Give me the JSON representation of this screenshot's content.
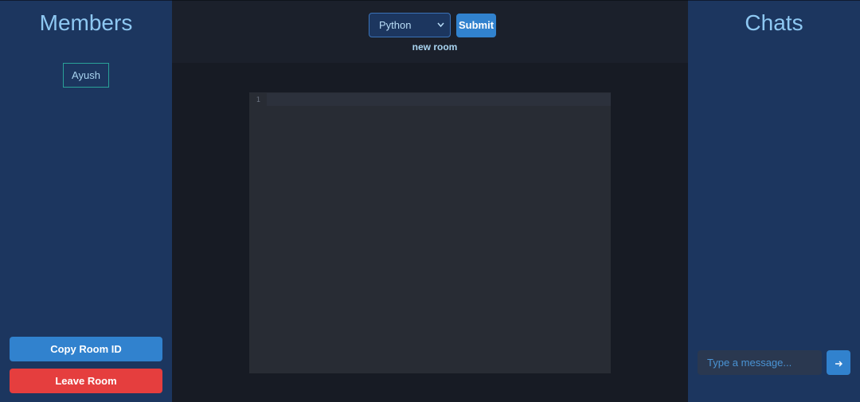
{
  "members_panel": {
    "title": "Members",
    "members": [
      {
        "name": "Ayush"
      }
    ],
    "copy_button": "Copy Room ID",
    "leave_button": "Leave Room"
  },
  "toolbar": {
    "language_selected": "Python",
    "language_dropdown_icon": "chevron-down-icon",
    "submit_label": "Submit",
    "room_name": "new room"
  },
  "editor": {
    "line_numbers": [
      "1"
    ],
    "content": ""
  },
  "chat_panel": {
    "title": "Chats",
    "input_placeholder": "Type a message...",
    "send_icon": "arrow-right-icon"
  },
  "colors": {
    "sidebar_bg": "#1c365f",
    "page_bg": "#171b24",
    "editor_bg": "#282c34",
    "accent_blue": "#3182ce",
    "danger_red": "#e53e3e",
    "member_border": "#2aa198",
    "title_text": "#8ec8f2"
  }
}
